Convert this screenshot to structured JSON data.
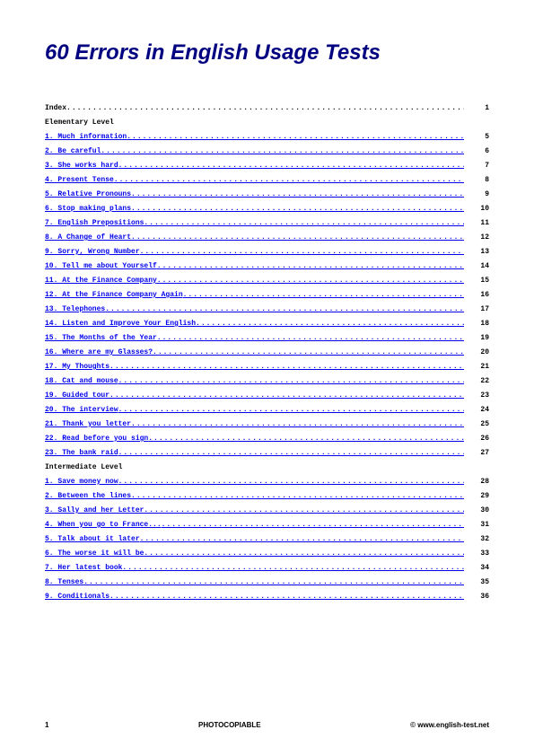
{
  "title": "60 Errors in English Usage Tests",
  "index": {
    "label": "Index",
    "page": "1"
  },
  "sections": [
    {
      "heading": "Elementary Level",
      "items": [
        {
          "n": "1",
          "label": "Much information",
          "page": "5"
        },
        {
          "n": "2",
          "label": "Be careful",
          "page": "6"
        },
        {
          "n": "3",
          "label": "She works hard",
          "page": "7"
        },
        {
          "n": "4",
          "label": "Present Tense",
          "page": "8"
        },
        {
          "n": "5",
          "label": "Relative Pronouns",
          "page": "9"
        },
        {
          "n": "6",
          "label": "Stop making plans",
          "page": "10"
        },
        {
          "n": "7",
          "label": "English Prepositions",
          "page": "11"
        },
        {
          "n": "8",
          "label": "A Change of Heart",
          "page": "12"
        },
        {
          "n": "9",
          "label": "Sorry, Wrong Number",
          "page": "13"
        },
        {
          "n": "10",
          "label": "Tell me about Yourself",
          "page": "14"
        },
        {
          "n": "11",
          "label": "At the Finance Company",
          "page": "15"
        },
        {
          "n": "12",
          "label": "At the Finance Company Again",
          "page": "16"
        },
        {
          "n": "13",
          "label": "Telephones",
          "page": "17"
        },
        {
          "n": "14",
          "label": "Listen and Improve Your English",
          "page": "18"
        },
        {
          "n": "15",
          "label": "The Months of the Year",
          "page": "19"
        },
        {
          "n": "16",
          "label": "Where are my Glasses?",
          "page": "20"
        },
        {
          "n": "17",
          "label": "My Thoughts",
          "page": "21"
        },
        {
          "n": "18",
          "label": "Cat and mouse",
          "page": "22"
        },
        {
          "n": "19",
          "label": "Guided tour",
          "page": "23"
        },
        {
          "n": "20",
          "label": "The interview",
          "page": "24"
        },
        {
          "n": "21",
          "label": "Thank you letter",
          "page": "25"
        },
        {
          "n": "22",
          "label": "Read before you sign",
          "page": "26"
        },
        {
          "n": "23",
          "label": "The bank raid",
          "page": "27"
        }
      ]
    },
    {
      "heading": "Intermediate Level",
      "items": [
        {
          "n": "1",
          "label": "Save money now",
          "page": "28"
        },
        {
          "n": "2",
          "label": "Between the lines",
          "page": "29"
        },
        {
          "n": "3",
          "label": "Sally and her Letter",
          "page": "30"
        },
        {
          "n": "4",
          "label": "When you go to France...",
          "page": "31"
        },
        {
          "n": "5",
          "label": "Talk about it later",
          "page": "32"
        },
        {
          "n": "6",
          "label": "The worse it will be",
          "page": "33"
        },
        {
          "n": "7",
          "label": "Her latest book",
          "page": "34"
        },
        {
          "n": "8",
          "label": "Tenses",
          "page": "35"
        },
        {
          "n": "9",
          "label": "Conditionals",
          "page": "36"
        }
      ]
    }
  ],
  "footer": {
    "page": "1",
    "center": "PHOTOCOPIABLE",
    "right": "© www.english-test.net"
  }
}
